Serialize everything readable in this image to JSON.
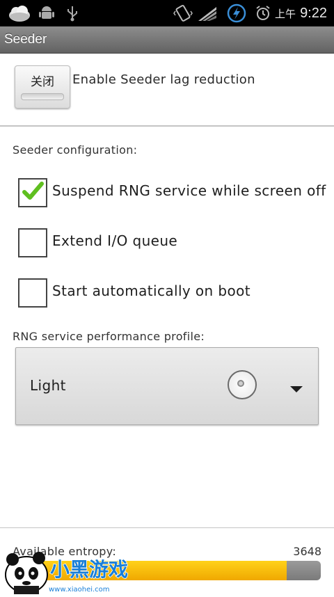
{
  "status_bar": {
    "ampm": "上午",
    "time": "9:22",
    "icons": [
      "weather-cloud-icon",
      "android-debug-icon",
      "usb-icon",
      "vibrate-icon",
      "signal-icon",
      "sync-icon",
      "alarm-icon"
    ]
  },
  "title_bar": {
    "title": "Seeder"
  },
  "toggle": {
    "button_label": "关闭",
    "description": "Enable Seeder lag reduction"
  },
  "config": {
    "heading": "Seeder configuration:",
    "options": [
      {
        "label": "Suspend RNG service while screen off",
        "checked": true
      },
      {
        "label": "Extend I/O queue",
        "checked": false
      },
      {
        "label": "Start automatically on boot",
        "checked": false
      }
    ]
  },
  "profile": {
    "heading": "RNG service performance profile:",
    "selected": "Light"
  },
  "entropy": {
    "label": "Available entropy:",
    "value": "3648",
    "fill_fraction": 0.89
  },
  "watermark": {
    "brand": "小黑游戏",
    "url": "www.xiaohei.com"
  },
  "colors": {
    "check": "#5fbf1f",
    "progress_fill": "#f7c000",
    "title_bar": "#7a7a7a"
  }
}
